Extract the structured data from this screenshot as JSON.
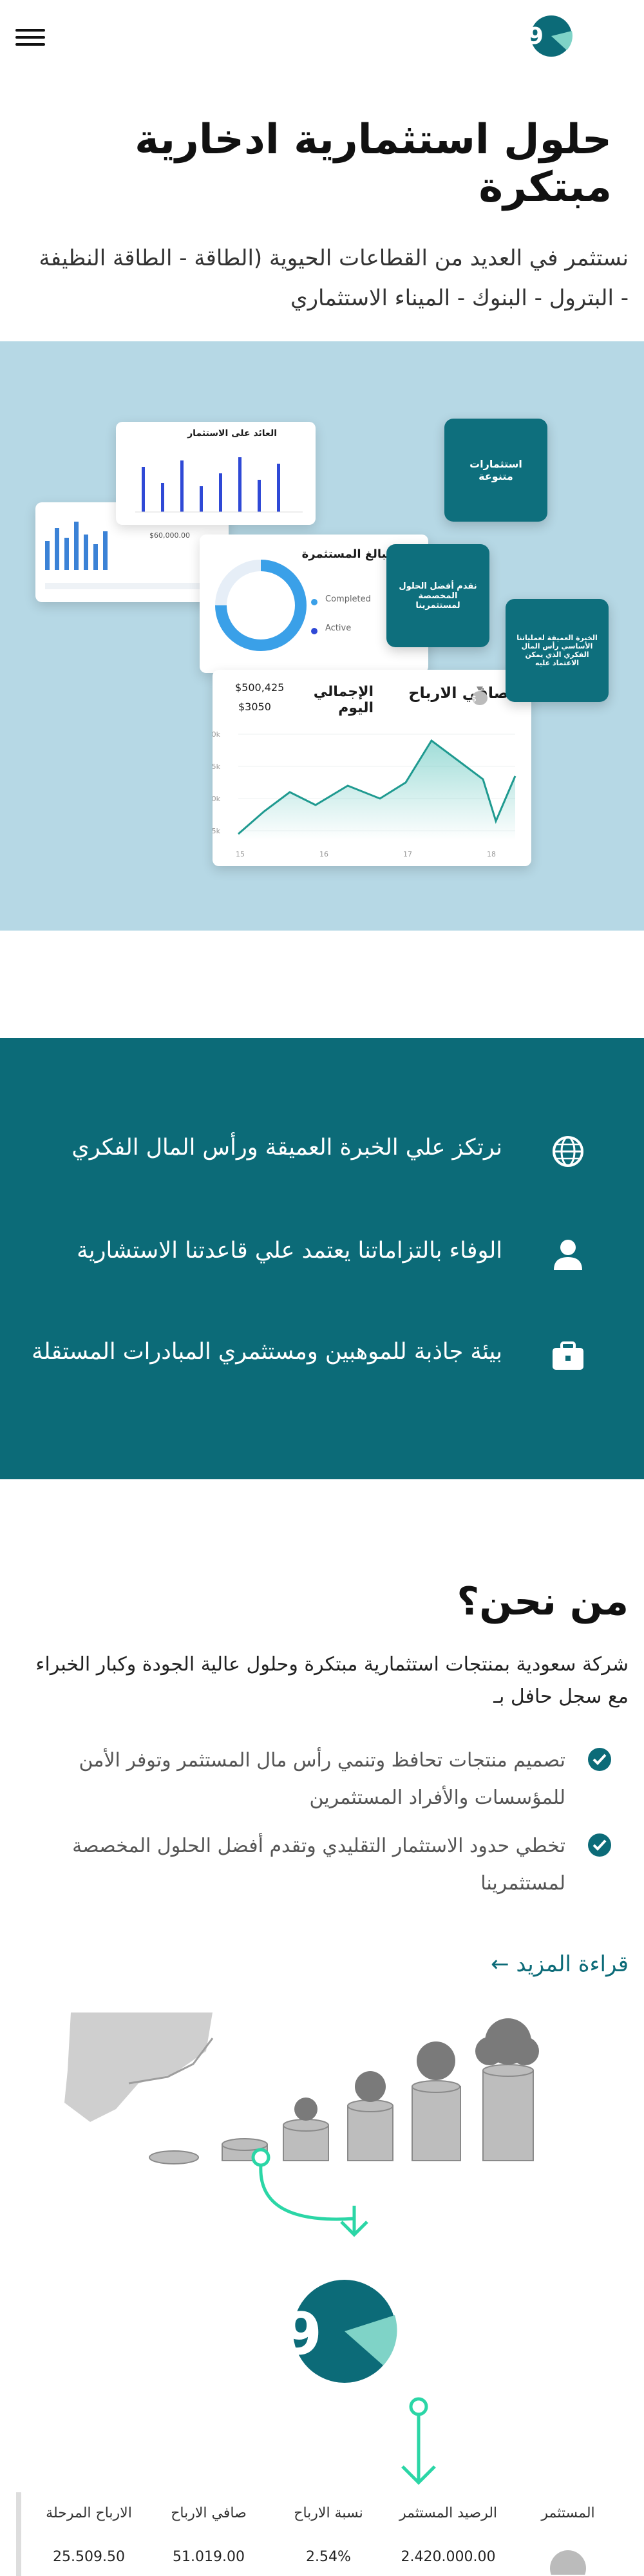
{
  "header": {
    "menu_icon": "hamburger-icon",
    "logo_icon": "brand-logo-icon"
  },
  "hero": {
    "title": "حلول استثمارية ادخارية مبتكرة",
    "subtitle_line1": "نستثمر في العديد من القطاعات الحيوية (الطاقة - الطاقة النظيفة",
    "subtitle_line2": "- البترول - البنوك - الميناء الاستثماري"
  },
  "dashboard": {
    "investment_return_title": "العائد على الاستثمار",
    "invested_amounts_title": "المبالغ المستثمرة",
    "gauge_value": "$60,000.00",
    "legend_completed": "Completed",
    "legend_active": "Active",
    "total_today_label": "الإجمالي اليوم",
    "total_today_value1": "$500,425",
    "total_today_value2": "$3050",
    "net_profit_label": "صافي الارباح",
    "chart_y_labels": [
      "20k",
      "15k",
      "10k",
      "5k"
    ],
    "chart_x_labels": [
      "15",
      "16",
      "17",
      "18"
    ],
    "card_diverse": "استثمارات متنوعة",
    "card_best_solutions": "نقدم أفضل الحلول المخصصة لمستثمرينا",
    "card_expertise": "الخبرة العميقة لعملياتنا الأساسي رأس المال الفكري الذي يمكن الاعتماد عليه"
  },
  "features": [
    {
      "icon": "globe-icon",
      "text": "نرتكز علي الخبرة العميقة ورأس المال الفكري"
    },
    {
      "icon": "user-icon",
      "text": "الوفاء بالتزاماتنا يعتمد علي قاعدتنا الاستشارية"
    },
    {
      "icon": "briefcase-icon",
      "text": "بيئة جاذبة للموهبين ومستثمري المبادرات المستقلة"
    }
  ],
  "about": {
    "title": "من نحن؟",
    "desc_line1": "شركة سعودية بمنتجات استثمارية مبتكرة وحلول عالية الجودة وكبار الخبراء",
    "desc_line2": "مع سجل حافل بـ",
    "items": [
      {
        "line1": "تصميم منتجات تحافظ وتنمي رأس مال المستثمر وتوفر الأمن",
        "line2": "للمؤسسات والأفراد المستثمرين"
      },
      {
        "line1": "تخطي حدود الاستثمار التقليدي وتقدم أفضل الحلول المخصصة",
        "line2": "لمستثمرينا"
      }
    ],
    "read_more": "قراءة المزيد ←"
  },
  "table": {
    "headers": [
      "المستثمر",
      "الرصيد المستثمر",
      "نسبة الارباح",
      "صافي الارباح",
      "الارباح المرحلة"
    ],
    "row": [
      "",
      "2.420.000.00",
      "2.54%",
      "51.019.00",
      "25.509.50"
    ]
  },
  "colors": {
    "teal": "#0c6b78",
    "light_blue": "#b6d8e5",
    "accent_green": "#2bd6a6"
  }
}
